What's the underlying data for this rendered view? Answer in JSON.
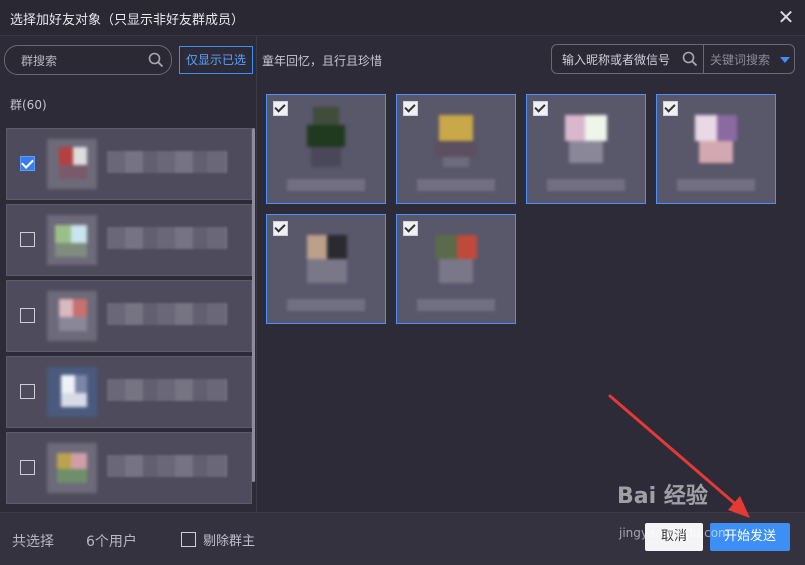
{
  "window": {
    "title": "选择加好友对象（只显示非好友群成员）"
  },
  "left_panel": {
    "search_placeholder": "群搜索",
    "only_selected_label": "仅显示已选",
    "group_count_label": "群(60)",
    "groups": [
      {
        "checked": true
      },
      {
        "checked": false
      },
      {
        "checked": false
      },
      {
        "checked": false
      },
      {
        "checked": false
      }
    ]
  },
  "right_panel": {
    "group_name": "童年回忆，且行且珍惜",
    "nick_search_placeholder": "输入昵称或者微信号",
    "keyword_select_label": "关键词搜索",
    "members": [
      {
        "checked": true
      },
      {
        "checked": true
      },
      {
        "checked": true
      },
      {
        "checked": true
      },
      {
        "checked": true
      },
      {
        "checked": true
      }
    ]
  },
  "footer": {
    "total_label": "共选择",
    "total_count": "6个用户",
    "remove_owner_label": "剔除群主",
    "cancel_label": "取消",
    "send_label": "开始发送"
  },
  "watermark": {
    "text": "Bai 经验",
    "sub": "jingyan.baidu.com"
  },
  "colors": {
    "accent": "#3d8ff6",
    "card_border": "#4a90ff",
    "annotation_arrow": "#e53935"
  },
  "icons": {
    "search": "search-icon",
    "close": "close-icon",
    "dropdown": "chevron-down-icon",
    "check": "check-icon"
  }
}
